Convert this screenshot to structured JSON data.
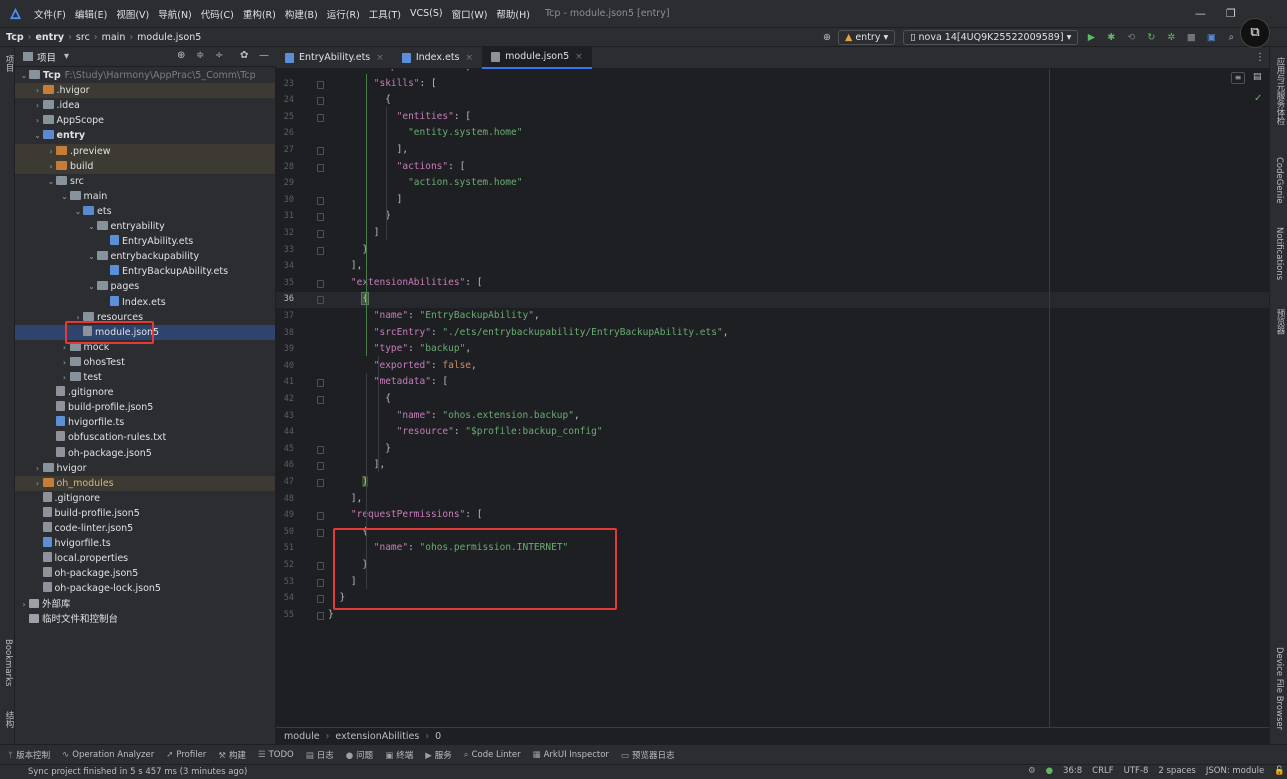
{
  "titlebar": {
    "menus": [
      "文件(F)",
      "编辑(E)",
      "视图(V)",
      "导航(N)",
      "代码(C)",
      "重构(R)",
      "构建(B)",
      "运行(R)",
      "工具(T)",
      "VCS(S)",
      "窗口(W)",
      "帮助(H)"
    ],
    "window_title": "Tcp - module.json5 [entry]"
  },
  "navbar": {
    "breadcrumb": [
      "Tcp",
      "entry",
      "src",
      "main",
      "module.json5"
    ],
    "run_config": "entry",
    "device": "nova 14[4UQ9K25522009589]"
  },
  "left_strip": {
    "project_label": "项目",
    "bookmarks": "Bookmarks",
    "structure": "结构"
  },
  "right_strip": {
    "app_services": "应用与元服务体检",
    "codegenie": "CodeGenie",
    "notifications": "Notifications",
    "previewer": "预览器",
    "device_file_browser": "Device File Browser"
  },
  "project_panel": {
    "title": "项目",
    "tree": [
      {
        "label": "Tcp",
        "extra": "F:\\Study\\Harmony\\AppPrac\\5_Comm\\Tcp",
        "depth": 0,
        "chev": "v",
        "icon": "folder",
        "bold": true
      },
      {
        "label": ".hvigor",
        "depth": 1,
        "chev": ">",
        "icon": "orange",
        "hl": true
      },
      {
        "label": ".idea",
        "depth": 1,
        "chev": ">",
        "icon": "folder"
      },
      {
        "label": "AppScope",
        "depth": 1,
        "chev": ">",
        "icon": "folder"
      },
      {
        "label": "entry",
        "depth": 1,
        "chev": "v",
        "icon": "blue",
        "bold": true
      },
      {
        "label": ".preview",
        "depth": 2,
        "chev": ">",
        "icon": "orange",
        "hl": true
      },
      {
        "label": "build",
        "depth": 2,
        "chev": ">",
        "icon": "orange",
        "hl": true
      },
      {
        "label": "src",
        "depth": 2,
        "chev": "v",
        "icon": "folder"
      },
      {
        "label": "main",
        "depth": 3,
        "chev": "v",
        "icon": "folder"
      },
      {
        "label": "ets",
        "depth": 4,
        "chev": "v",
        "icon": "blue"
      },
      {
        "label": "entryability",
        "depth": 5,
        "chev": "v",
        "icon": "folder"
      },
      {
        "label": "EntryAbility.ets",
        "depth": 6,
        "chev": "",
        "icon": "fileb"
      },
      {
        "label": "entrybackupability",
        "depth": 5,
        "chev": "v",
        "icon": "folder"
      },
      {
        "label": "EntryBackupAbility.ets",
        "depth": 6,
        "chev": "",
        "icon": "fileb"
      },
      {
        "label": "pages",
        "depth": 5,
        "chev": "v",
        "icon": "folder"
      },
      {
        "label": "Index.ets",
        "depth": 6,
        "chev": "",
        "icon": "fileb"
      },
      {
        "label": "resources",
        "depth": 4,
        "chev": ">",
        "icon": "folder"
      },
      {
        "label": "module.json5",
        "depth": 4,
        "chev": "",
        "icon": "file",
        "sel": true
      },
      {
        "label": "mock",
        "depth": 3,
        "chev": ">",
        "icon": "folder"
      },
      {
        "label": "ohosTest",
        "depth": 3,
        "chev": ">",
        "icon": "folder"
      },
      {
        "label": "test",
        "depth": 3,
        "chev": ">",
        "icon": "folder"
      },
      {
        "label": ".gitignore",
        "depth": 2,
        "chev": "",
        "icon": "file"
      },
      {
        "label": "build-profile.json5",
        "depth": 2,
        "chev": "",
        "icon": "file"
      },
      {
        "label": "hvigorfile.ts",
        "depth": 2,
        "chev": "",
        "icon": "fileb"
      },
      {
        "label": "obfuscation-rules.txt",
        "depth": 2,
        "chev": "",
        "icon": "file"
      },
      {
        "label": "oh-package.json5",
        "depth": 2,
        "chev": "",
        "icon": "file"
      },
      {
        "label": "hvigor",
        "depth": 1,
        "chev": ">",
        "icon": "folder"
      },
      {
        "label": "oh_modules",
        "depth": 1,
        "chev": ">",
        "icon": "orange",
        "hl": true,
        "orangetxt": true
      },
      {
        "label": ".gitignore",
        "depth": 1,
        "chev": "",
        "icon": "file"
      },
      {
        "label": "build-profile.json5",
        "depth": 1,
        "chev": "",
        "icon": "file"
      },
      {
        "label": "code-linter.json5",
        "depth": 1,
        "chev": "",
        "icon": "file"
      },
      {
        "label": "hvigorfile.ts",
        "depth": 1,
        "chev": "",
        "icon": "fileb"
      },
      {
        "label": "local.properties",
        "depth": 1,
        "chev": "",
        "icon": "file"
      },
      {
        "label": "oh-package.json5",
        "depth": 1,
        "chev": "",
        "icon": "file"
      },
      {
        "label": "oh-package-lock.json5",
        "depth": 1,
        "chev": "",
        "icon": "file"
      },
      {
        "label": "外部库",
        "depth": 0,
        "chev": ">",
        "icon": "lib"
      },
      {
        "label": "临时文件和控制台",
        "depth": 0,
        "chev": "",
        "icon": "lib"
      }
    ]
  },
  "tabs": [
    {
      "label": "EntryAbility.ets",
      "active": false
    },
    {
      "label": "Index.ets",
      "active": false
    },
    {
      "label": "module.json5",
      "active": true
    }
  ],
  "editor": {
    "current_line": 36,
    "lines": [
      {
        "n": 22,
        "html": "        <span class='k'>\"exported\"</span>: <span class='kw'>true</span>,"
      },
      {
        "n": 23,
        "html": "        <span class='k'>\"skills\"</span>: ["
      },
      {
        "n": 24,
        "html": "          {"
      },
      {
        "n": 25,
        "html": "            <span class='k'>\"entities\"</span>: ["
      },
      {
        "n": 26,
        "html": "              <span class='s'>\"entity.system.home\"</span>"
      },
      {
        "n": 27,
        "html": "            ],"
      },
      {
        "n": 28,
        "html": "            <span class='k'>\"actions\"</span>: ["
      },
      {
        "n": 29,
        "html": "              <span class='s'>\"action.system.home\"</span>"
      },
      {
        "n": 30,
        "html": "            ]"
      },
      {
        "n": 31,
        "html": "          }"
      },
      {
        "n": 32,
        "html": "        ]"
      },
      {
        "n": 33,
        "html": "      }"
      },
      {
        "n": 34,
        "html": "    ],"
      },
      {
        "n": 35,
        "html": "    <span class='k'>\"extensionAbilities\"</span>: ["
      },
      {
        "n": 36,
        "html": "      <span class='brk'>{</span>"
      },
      {
        "n": 37,
        "html": "        <span class='k'>\"name\"</span>: <span class='s'>\"EntryBackupAbility\"</span>,"
      },
      {
        "n": 38,
        "html": "        <span class='k'>\"srcEntry\"</span>: <span class='s'>\"./ets/entrybackupability/EntryBackupAbility.ets\"</span>,"
      },
      {
        "n": 39,
        "html": "        <span class='k'>\"type\"</span>: <span class='s'>\"backup\"</span>,"
      },
      {
        "n": 40,
        "html": "        <span class='k'>\"exported\"</span>: <span class='kw'>false</span>,"
      },
      {
        "n": 41,
        "html": "        <span class='k'>\"metadata\"</span>: ["
      },
      {
        "n": 42,
        "html": "          {"
      },
      {
        "n": 43,
        "html": "            <span class='k'>\"name\"</span>: <span class='s'>\"ohos.extension.backup\"</span>,"
      },
      {
        "n": 44,
        "html": "            <span class='k'>\"resource\"</span>: <span class='s'>\"$profile:backup_config\"</span>"
      },
      {
        "n": 45,
        "html": "          }"
      },
      {
        "n": 46,
        "html": "        ],"
      },
      {
        "n": 47,
        "html": "      <span class='brk2'>}</span>"
      },
      {
        "n": 48,
        "html": "    ],"
      },
      {
        "n": 49,
        "html": "    <span class='k'>\"requestPermissions\"</span>: ["
      },
      {
        "n": 50,
        "html": "      {"
      },
      {
        "n": 51,
        "html": "        <span class='k'>\"name\"</span>: <span class='s'>\"ohos.permission.INTERNET\"</span>"
      },
      {
        "n": 52,
        "html": "      }"
      },
      {
        "n": 53,
        "html": "    ]"
      },
      {
        "n": 54,
        "html": "  }"
      },
      {
        "n": 55,
        "html": "}"
      }
    ]
  },
  "breadcrumb_bottom": [
    "module",
    "extensionAbilities",
    "0"
  ],
  "bottom_tools": [
    "版本控制",
    "Operation Analyzer",
    "Profiler",
    "构建",
    "TODO",
    "日志",
    "问题",
    "终端",
    "服务",
    "Code Linter",
    "ArkUI Inspector",
    "预览器日志"
  ],
  "status": {
    "message": "Sync project finished in 5 s 457 ms (3 minutes ago)",
    "position": "36:8",
    "line_sep": "CRLF",
    "encoding": "UTF-8",
    "indent": "2 spaces",
    "filetype": "JSON: module"
  },
  "colors": {
    "accent": "#3574f0",
    "highlight": "#e53935"
  }
}
